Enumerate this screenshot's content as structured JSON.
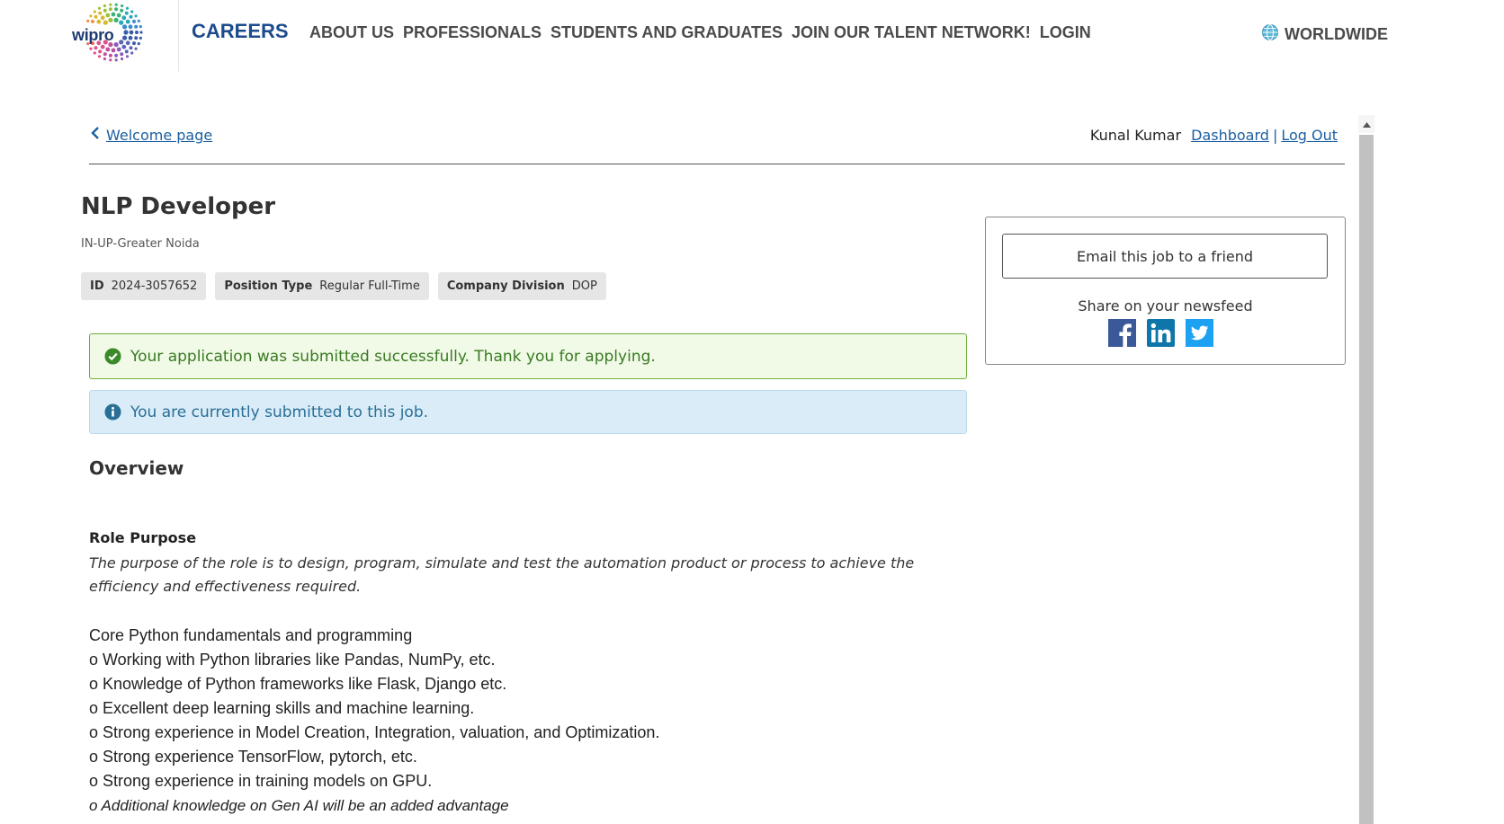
{
  "header": {
    "logo_text": "wipro",
    "careers": "CAREERS",
    "nav": [
      "ABOUT US",
      "PROFESSIONALS",
      "STUDENTS AND GRADUATES",
      "JOIN OUR TALENT NETWORK!",
      "LOGIN"
    ],
    "region": "WORLDWIDE"
  },
  "subheader": {
    "back_label": "Welcome page",
    "user_name": "Kunal Kumar",
    "dashboard": "Dashboard",
    "separator": "|",
    "logout": "Log Out"
  },
  "job": {
    "title": "NLP Developer",
    "location": "IN-UP-Greater Noida",
    "tags": [
      {
        "label": "ID",
        "value": "2024-3057652"
      },
      {
        "label": "Position Type",
        "value": "Regular Full-Time"
      },
      {
        "label": "Company Division",
        "value": "DOP"
      }
    ]
  },
  "alerts": {
    "success": "Your application was submitted successfully. Thank you for applying.",
    "info": "You are currently submitted to this job."
  },
  "content": {
    "overview": "Overview",
    "role_heading": "Role Purpose",
    "role_desc": "The purpose of the role is to design, program, simulate and test the automation product or process to achieve the efficiency and effectiveness required.",
    "lines": [
      "Core Python fundamentals and programming",
      "o Working with Python libraries like Pandas, NumPy, etc.",
      "o Knowledge of Python frameworks like Flask, Django etc.",
      "o Excellent deep learning skills and machine learning.",
      "o Strong experience in Model Creation, Integration, valuation, and Optimization.",
      "o Strong experience TensorFlow, pytorch, etc.",
      "o Strong experience in training models on GPU.",
      "o Additional knowledge on Gen AI will be an added advantage"
    ]
  },
  "sidebar": {
    "email_button": "Email this job to a friend",
    "share_label": "Share on your newsfeed",
    "social": [
      "facebook-icon",
      "linkedin-icon",
      "twitter-icon"
    ]
  },
  "colors": {
    "brand_blue": "#1c4b8c",
    "link": "#1b5fa0",
    "success_border": "#6fae3a",
    "info_bg": "#d9ecf7"
  }
}
